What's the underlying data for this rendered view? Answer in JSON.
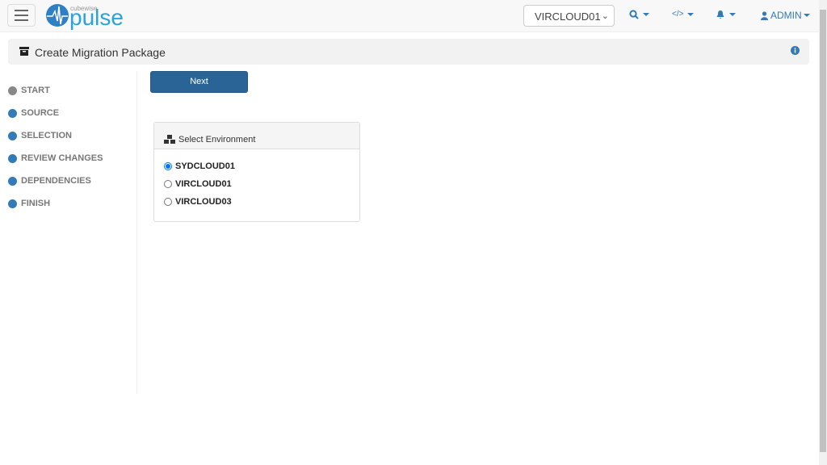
{
  "header": {
    "logo_small": "cubewise",
    "logo_main": "pulse",
    "environment_select": "VIRCLOUD01",
    "user_label": "ADMIN"
  },
  "page": {
    "title": "Create Migration Package"
  },
  "wizard": {
    "steps": [
      {
        "label": "START",
        "state": "current"
      },
      {
        "label": "SOURCE"
      },
      {
        "label": "SELECTION"
      },
      {
        "label": "REVIEW CHANGES"
      },
      {
        "label": "DEPENDENCIES"
      },
      {
        "label": "FINISH"
      }
    ],
    "next_label": "Next"
  },
  "environment_card": {
    "title": "Select Environment",
    "options": [
      {
        "label": "SYDCLOUD01",
        "checked": true
      },
      {
        "label": "VIRCLOUD01",
        "checked": false
      },
      {
        "label": "VIRCLOUD03",
        "checked": false
      }
    ]
  },
  "colors": {
    "accent": "#337ab7",
    "button": "#2a6496",
    "logo": "#29a3dc"
  }
}
